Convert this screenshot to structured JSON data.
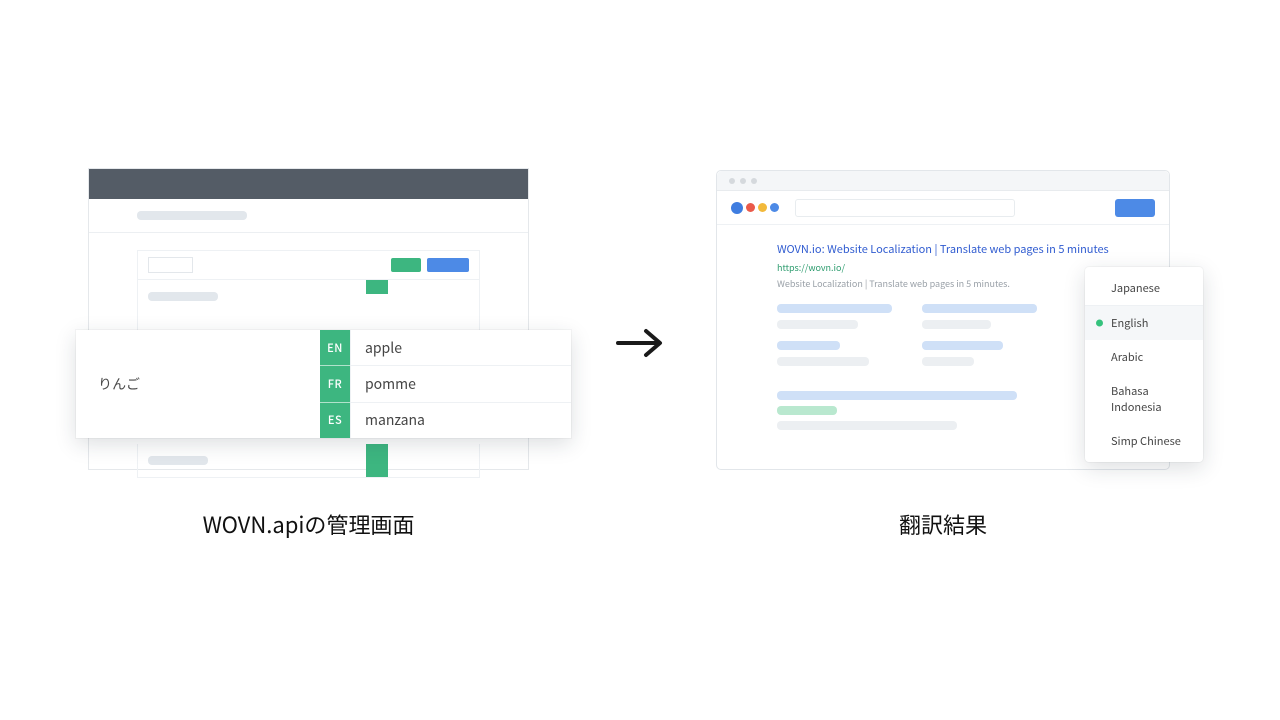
{
  "left": {
    "caption": "WOVN.apiの管理画面",
    "source_term": "りんご",
    "translations": [
      {
        "lang": "EN",
        "word": "apple"
      },
      {
        "lang": "FR",
        "word": "pomme"
      },
      {
        "lang": "ES",
        "word": "manzana"
      }
    ]
  },
  "right": {
    "caption": "翻訳結果",
    "result": {
      "title": "WOVN.io: Website Localization | Translate web pages in 5 minutes",
      "url": "https://wovn.io/",
      "desc": "Website Localization | Translate web pages in 5 minutes."
    },
    "languages": [
      "Japanese",
      "English",
      "Arabic",
      "Bahasa Indonesia",
      "Simp Chinese"
    ],
    "selected_language": "English"
  }
}
